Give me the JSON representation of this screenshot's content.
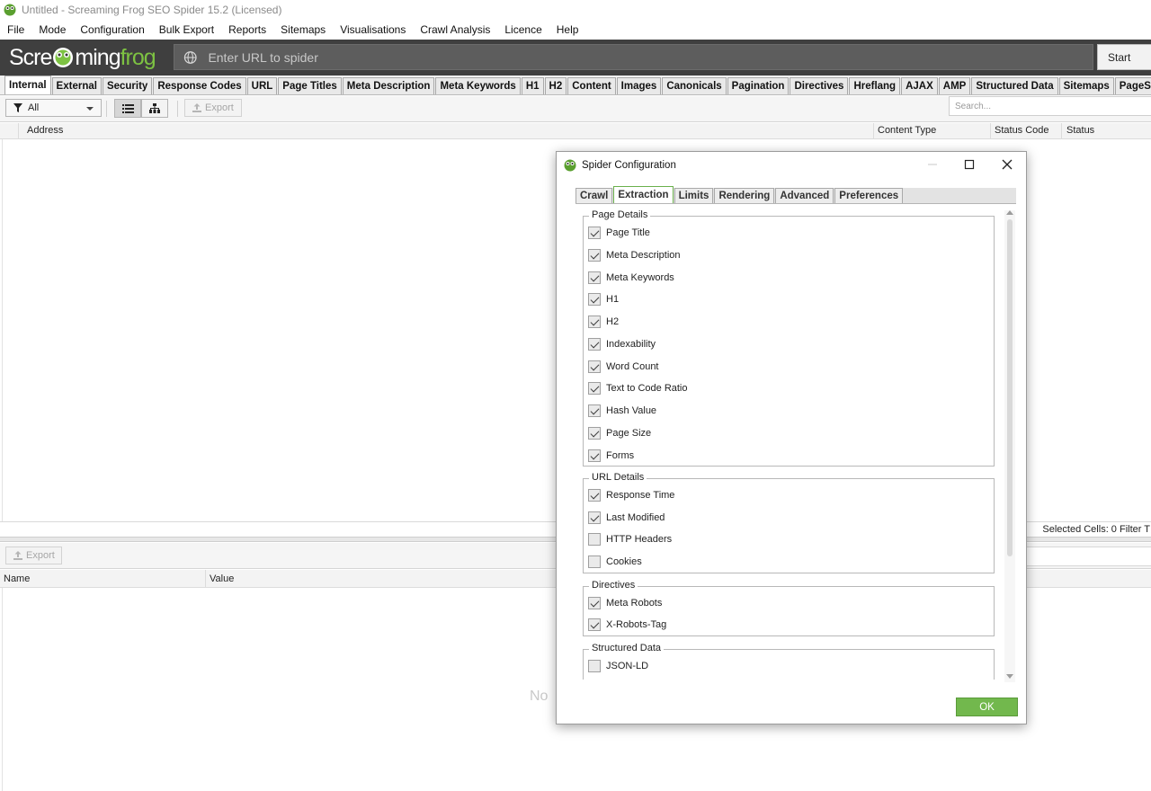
{
  "window": {
    "title": "Untitled - Screaming Frog SEO Spider 15.2 (Licensed)"
  },
  "menu": [
    "File",
    "Mode",
    "Configuration",
    "Bulk Export",
    "Reports",
    "Sitemaps",
    "Visualisations",
    "Crawl Analysis",
    "Licence",
    "Help"
  ],
  "logo": {
    "part1": "Scre",
    "part2": "ming",
    "part3": "frog"
  },
  "url_bar": {
    "placeholder": "Enter URL to spider",
    "start_label": "Start"
  },
  "main_tabs": [
    "Internal",
    "External",
    "Security",
    "Response Codes",
    "URL",
    "Page Titles",
    "Meta Description",
    "Meta Keywords",
    "H1",
    "H2",
    "Content",
    "Images",
    "Canonicals",
    "Pagination",
    "Directives",
    "Hreflang",
    "AJAX",
    "AMP",
    "Structured Data",
    "Sitemaps",
    "PageSpeed"
  ],
  "toolbar": {
    "filter_value": "All",
    "export_label": "Export",
    "search_placeholder": "Search..."
  },
  "columns": {
    "address": "Address",
    "content_type": "Content Type",
    "status_code": "Status Code",
    "status": "Status"
  },
  "status_strip": {
    "text": "Selected Cells:  0  Filter T"
  },
  "lower": {
    "export_label": "Export",
    "name_col": "Name",
    "value_col": "Value",
    "no_data": "No"
  },
  "dialog": {
    "title": "Spider Configuration",
    "tabs": [
      "Crawl",
      "Extraction",
      "Limits",
      "Rendering",
      "Advanced",
      "Preferences"
    ],
    "active_tab": "Extraction",
    "groups": {
      "page_details": {
        "label": "Page Details",
        "items": [
          {
            "label": "Page Title",
            "checked": true
          },
          {
            "label": "Meta Description",
            "checked": true
          },
          {
            "label": "Meta Keywords",
            "checked": true
          },
          {
            "label": "H1",
            "checked": true
          },
          {
            "label": "H2",
            "checked": true
          },
          {
            "label": "Indexability",
            "checked": true
          },
          {
            "label": "Word Count",
            "checked": true
          },
          {
            "label": "Text to Code Ratio",
            "checked": true
          },
          {
            "label": "Hash Value",
            "checked": true
          },
          {
            "label": "Page Size",
            "checked": true
          },
          {
            "label": "Forms",
            "checked": true
          }
        ]
      },
      "url_details": {
        "label": "URL Details",
        "items": [
          {
            "label": "Response Time",
            "checked": true
          },
          {
            "label": "Last Modified",
            "checked": true
          },
          {
            "label": "HTTP Headers",
            "checked": false
          },
          {
            "label": "Cookies",
            "checked": false
          }
        ]
      },
      "directives": {
        "label": "Directives",
        "items": [
          {
            "label": "Meta Robots",
            "checked": true
          },
          {
            "label": "X-Robots-Tag",
            "checked": true
          }
        ]
      },
      "structured_data": {
        "label": "Structured Data",
        "items": [
          {
            "label": "JSON-LD",
            "checked": false
          }
        ]
      }
    },
    "ok_label": "OK"
  },
  "colors": {
    "brand_green": "#7dc242",
    "ok_green": "#72b84d",
    "urlbar_bg": "#3f3f3f"
  }
}
